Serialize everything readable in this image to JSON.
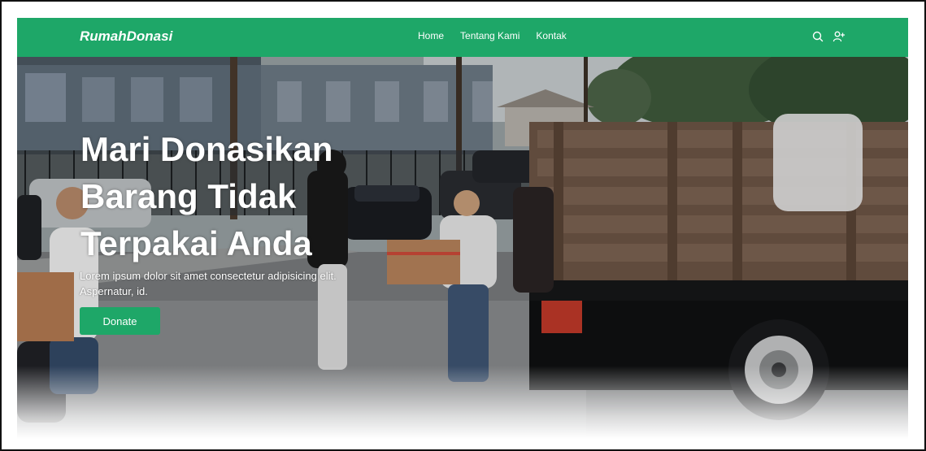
{
  "brand": {
    "name": "RumahDonasi"
  },
  "nav": {
    "links": [
      {
        "label": "Home"
      },
      {
        "label": "Tentang Kami"
      },
      {
        "label": "Kontak"
      }
    ],
    "icons": [
      "search-icon",
      "add-user-icon"
    ]
  },
  "hero": {
    "title": "Mari Donasikan Barang Tidak Terpakai Anda",
    "subtitle": "Lorem ipsum dolor sit amet consectetur adipisicing elit. Aspernatur, id.",
    "button_label": "Donate",
    "image_subject": "volunteers loading donation boxes onto a truck on a street"
  },
  "colors": {
    "accent": "#1ea768",
    "text_on_accent": "#ffffff"
  }
}
